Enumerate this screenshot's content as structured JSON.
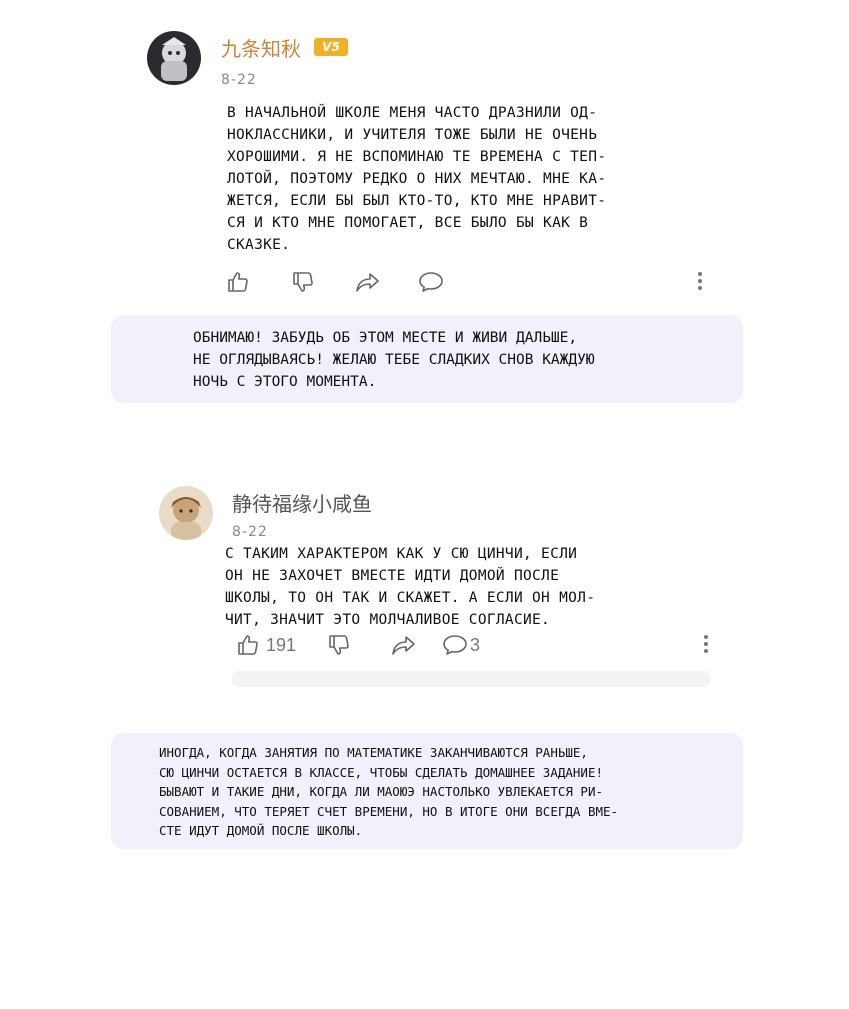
{
  "comments": [
    {
      "username": "九条知秋",
      "vip_badge": "V5",
      "date": "8-22",
      "text_lines": [
        "В начальной школе меня часто дразнили од-",
        "ноклассники, и учителя тоже были не очень",
        "хорошими. Я не вспоминаю те времена с теп-",
        "лотой, поэтому редко о них мечтаю. Мне ка-",
        "жется, если бы был кто-то, кто мне нравит-",
        "ся и кто мне помогает, все было бы как в",
        "сказке."
      ],
      "translator_note_lines": [
        "Обнимаю! Забудь об этом месте и живи дальше,",
        "не оглядываясь! Желаю тебе сладких снов каждую",
        "ночь с этого момента."
      ]
    },
    {
      "username": "静待福缘小咸鱼",
      "date": "8-22",
      "text_lines": [
        "С таким характером как у Сю Цинчи, если",
        "он не захочет вместе идти домой после",
        "школы, то он так и скажет. А если он мол-",
        "чит, значит это молчаливое согласие."
      ],
      "likes": "191",
      "replies": "3",
      "translator_note_lines": [
        "Иногда, когда занятия по математике заканчиваются раньше,",
        "Сю Цинчи остается в классе, чтобы сделать домашнее задание!",
        "Бывают и такие дни, когда Ли Маоюэ настолько увлекается ри-",
        "сованием, что теряет счет времени, но в итоге они всегда вме-",
        "сте идут домой после школы."
      ]
    }
  ],
  "icons": [
    "thumbs-up-icon",
    "thumbs-down-icon",
    "share-icon",
    "comment-icon",
    "more-icon"
  ],
  "colors": {
    "username_vip": "#c8873a",
    "vip_badge": "#f0b128",
    "note_bubble": "#f1f1fb",
    "meta": "#8a8a8a"
  }
}
